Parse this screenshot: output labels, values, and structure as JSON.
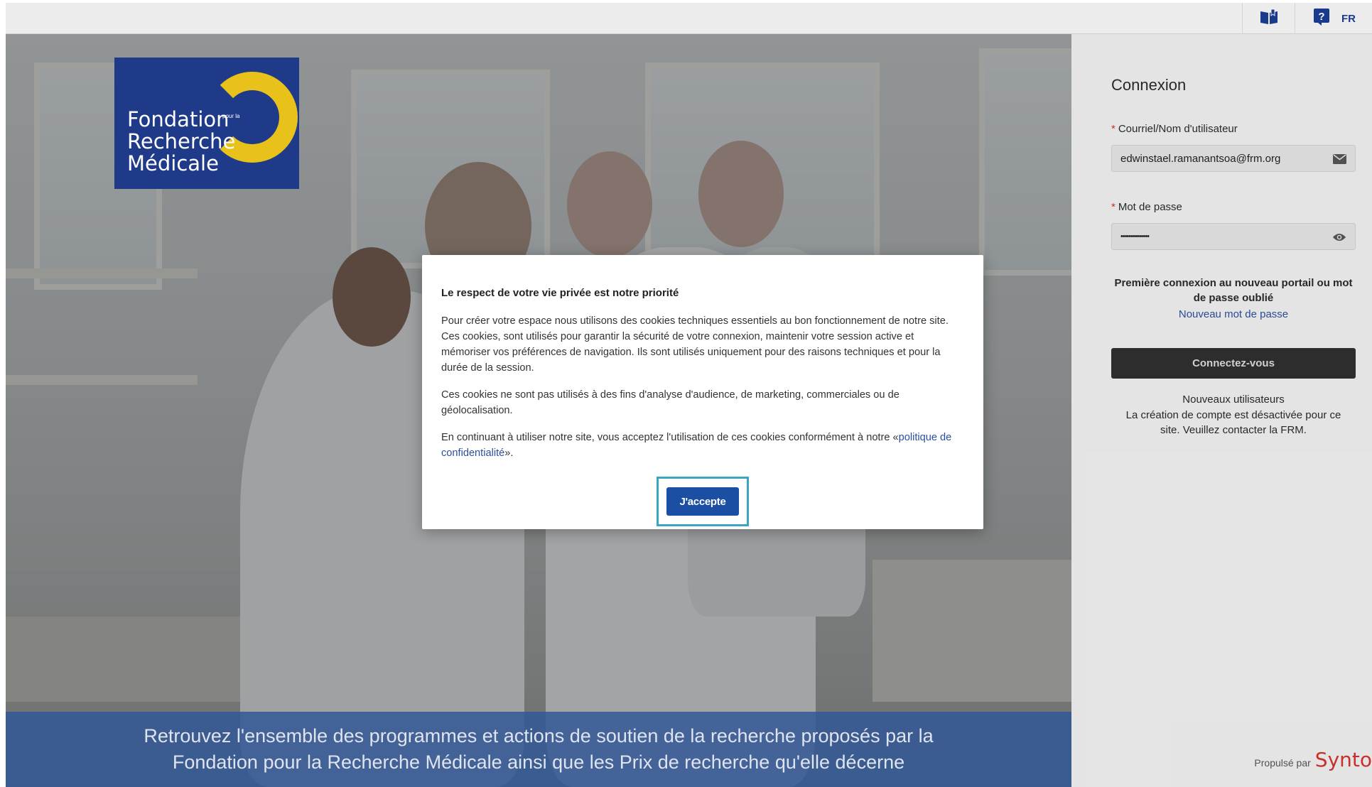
{
  "topbar": {
    "manual_icon": "book-icon",
    "help_icon": "help-icon",
    "language": "FR"
  },
  "logo": {
    "line1": "Fondation",
    "line2": "Recherche",
    "line3": "Médicale",
    "small": "pour la"
  },
  "hero": {
    "banner_text": "Retrouvez l'ensemble des programmes et actions de soutien de la recherche proposés par la Fondation pour la Recherche Médicale ainsi que les Prix de recherche qu'elle décerne"
  },
  "login": {
    "title": "Connexion",
    "username_label": "Courriel/Nom d'utilisateur",
    "username_value": "edwinstael.ramanantsoa@frm.org",
    "password_label": "Mot de passe",
    "password_value": "••••••••••••••",
    "first_login_note": "Première connexion au nouveau portail ou mot de passe oublié",
    "new_password_link": "Nouveau mot de passe",
    "submit_label": "Connectez-vous",
    "new_users_title": "Nouveaux utilisateurs",
    "new_users_note": "La création de compte est désactivée pour ce site. Veuillez contacter la FRM.",
    "powered_by": "Propulsé par",
    "powered_brand": "Synto"
  },
  "cookie_modal": {
    "title": "Le respect de votre vie privée est notre priorité",
    "paragraph1": "Pour créer votre espace nous utilisons des cookies techniques essentiels au bon fonctionnement de notre site. Ces cookies, sont utilisés pour garantir la sécurité de votre connexion, maintenir votre session active et mémoriser vos préférences de navigation. Ils sont utilisés uniquement pour des raisons techniques et pour la durée de la session.",
    "paragraph2": "Ces cookies ne sont pas utilisés à des fins d'analyse d'audience, de marketing, commerciales ou de géolocalisation.",
    "paragraph3_prefix": "En continuant à utiliser notre site, vous acceptez l'utilisation de ces cookies conformément à notre «",
    "paragraph3_link": "politique de confidentialité",
    "paragraph3_suffix": "».",
    "accept_label": "J'accepte"
  },
  "colors": {
    "brand_blue": "#203a8a",
    "brand_yellow": "#e8c21a",
    "accept_blue": "#1b4fa3",
    "focus_ring": "#3aa7c0",
    "required_red": "#d0342c"
  }
}
